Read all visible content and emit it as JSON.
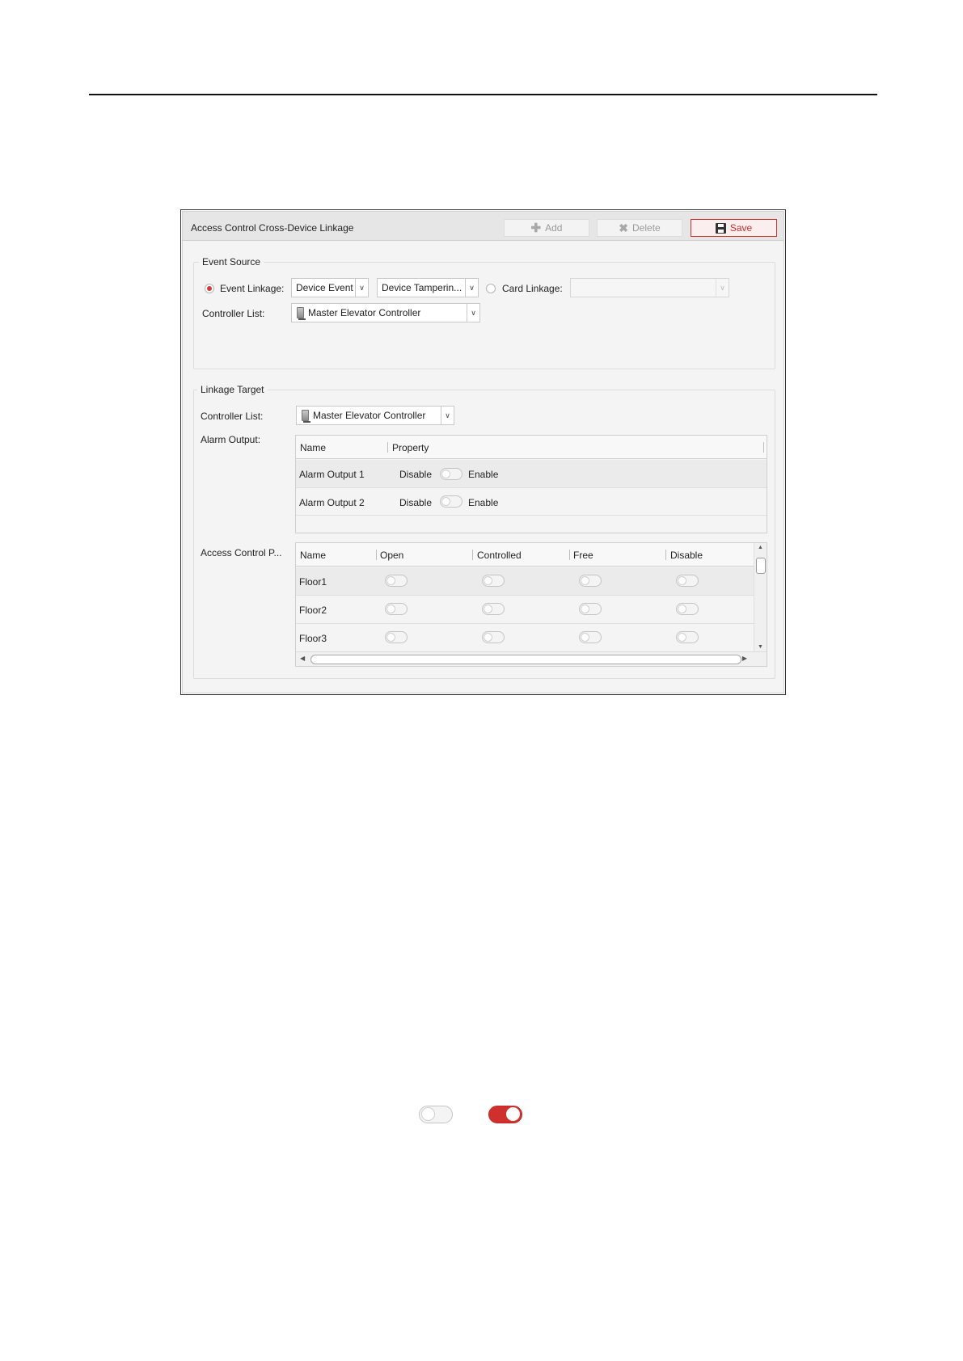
{
  "window": {
    "title": "Access Control Cross-Device Linkage",
    "add_label": "Add",
    "delete_label": "Delete",
    "save_label": "Save"
  },
  "event_source": {
    "legend": "Event Source",
    "event_linkage_label": "Event Linkage:",
    "event_type": "Device Event",
    "event_subtype": "Device Tamperin...",
    "card_linkage_label": "Card Linkage:",
    "card_linkage_value": "",
    "controller_list_label": "Controller List:",
    "controller": "Master Elevator Controller"
  },
  "linkage_target": {
    "legend": "Linkage Target",
    "controller_list_label": "Controller List:",
    "controller": "Master Elevator Controller",
    "alarm_output_label": "Alarm Output:",
    "alarm_table": {
      "columns": [
        "Name",
        "Property"
      ],
      "rows": [
        {
          "name": "Alarm Output 1",
          "off_label": "Disable",
          "on_label": "Enable",
          "enabled": false
        },
        {
          "name": "Alarm Output 2",
          "off_label": "Disable",
          "on_label": "Enable",
          "enabled": false
        }
      ]
    },
    "access_control_point_label": "Access Control P...",
    "floor_table": {
      "columns": [
        "Name",
        "Open",
        "Controlled",
        "Free",
        "Disable"
      ],
      "rows": [
        {
          "name": "Floor1",
          "open": false,
          "controlled": false,
          "free": false,
          "disable": false
        },
        {
          "name": "Floor2",
          "open": false,
          "controlled": false,
          "free": false,
          "disable": false
        },
        {
          "name": "Floor3",
          "open": false,
          "controlled": false,
          "free": false,
          "disable": false
        }
      ]
    }
  },
  "toggle_examples": {
    "first": false,
    "second": true
  },
  "colors": {
    "accent": "#d0302d",
    "background": "#f4f4f4",
    "border": "#cfcfcf"
  },
  "icons": [
    "plus-icon",
    "delete-x-icon",
    "save-disk-icon",
    "chevron-down-icon",
    "controller-device-icon"
  ]
}
